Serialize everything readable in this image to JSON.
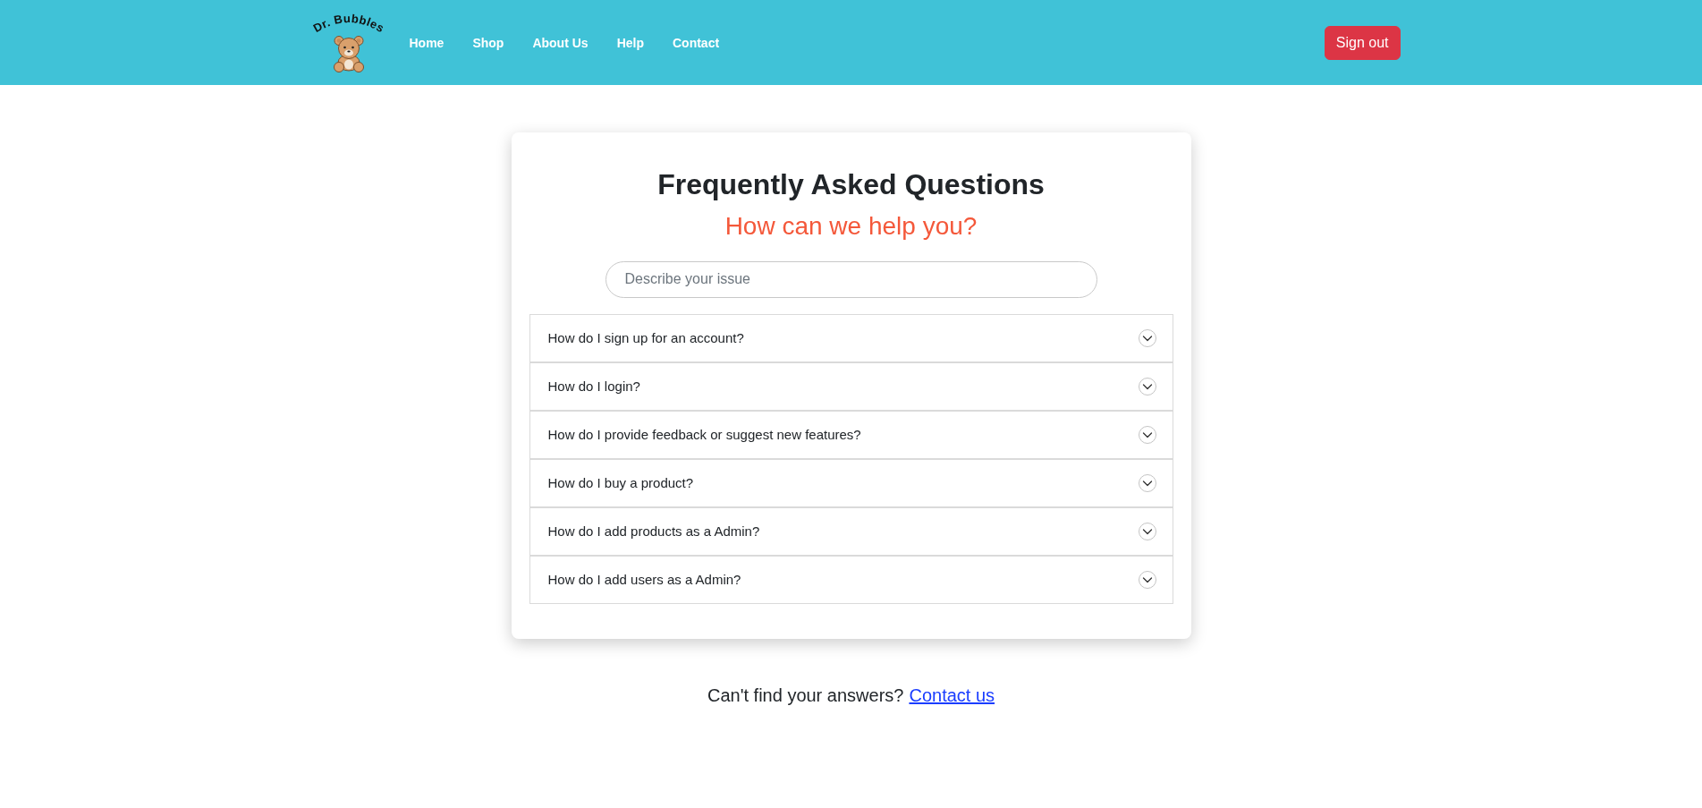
{
  "header": {
    "logo": {
      "text": "Dr. Bubbles"
    },
    "nav": [
      {
        "label": "Home"
      },
      {
        "label": "Shop"
      },
      {
        "label": "About Us"
      },
      {
        "label": "Help"
      },
      {
        "label": "Contact"
      }
    ],
    "sign_out": {
      "label": "Sign out"
    }
  },
  "faq": {
    "title": "Frequently Asked Questions",
    "subtitle": "How can we help you?",
    "search": {
      "placeholder": "Describe your issue"
    },
    "questions": [
      {
        "text": "How do I sign up for an account?",
        "expanded": false
      },
      {
        "text": "How do I login?",
        "expanded": false
      },
      {
        "text": "How do I provide feedback or suggest new features?",
        "expanded": false
      },
      {
        "text": "How do I buy a product?",
        "expanded": false
      },
      {
        "text": "How do I add products as a Admin?",
        "expanded": false
      },
      {
        "text": "How do I add users as a Admin?",
        "expanded": false
      }
    ]
  },
  "footer": {
    "text": "Can't find your answers?",
    "link": "Contact us"
  }
}
